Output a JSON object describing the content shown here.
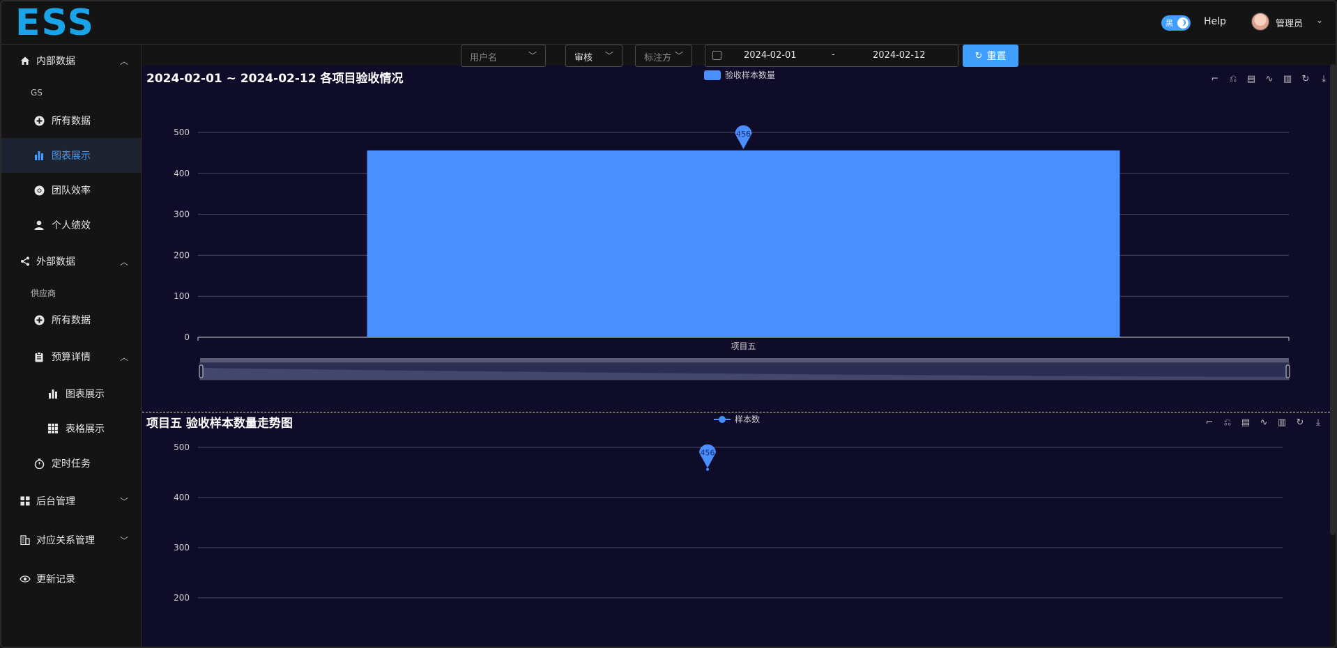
{
  "header": {
    "logo_text": "ESS",
    "theme_toggle_label": "黑",
    "help_label": "Help",
    "user_name": "管理员",
    "user_caret": "⌄"
  },
  "sidebar": {
    "internal_group": {
      "label": "内部数据",
      "icon": "home-icon",
      "expanded": true
    },
    "internal_sub_label": "GS",
    "internal_items": [
      {
        "label": "所有数据",
        "icon": "plus-circle-icon"
      },
      {
        "label": "图表展示",
        "icon": "bar-chart-icon",
        "active": true
      },
      {
        "label": "团队效率",
        "icon": "chrome-icon"
      },
      {
        "label": "个人绩效",
        "icon": "user-icon"
      }
    ],
    "external_group": {
      "label": "外部数据",
      "icon": "share-icon",
      "expanded": true
    },
    "external_sub_label": "供应商",
    "external_items": [
      {
        "label": "所有数据",
        "icon": "plus-circle-icon"
      },
      {
        "label": "预算详情",
        "icon": "clipboard-icon",
        "expanded": true
      }
    ],
    "budget_items": [
      {
        "label": "图表展示",
        "icon": "bar-chart-icon"
      },
      {
        "label": "表格展示",
        "icon": "grid-icon"
      }
    ],
    "timer_item": {
      "label": "定时任务",
      "icon": "timer-icon"
    },
    "admin_group": {
      "label": "后台管理",
      "icon": "apps-icon"
    },
    "mapping_group": {
      "label": "对应关系管理",
      "icon": "building-icon"
    },
    "changelog_item": {
      "label": "更新记录",
      "icon": "eye-icon"
    }
  },
  "filters": {
    "username_placeholder": "用户名",
    "review_value": "审核",
    "annotator_placeholder": "标注方",
    "date_start": "2024-02-01",
    "date_separator": "-",
    "date_end": "2024-02-12",
    "reset_label": "重置"
  },
  "colors": {
    "accent": "#409eff",
    "bar": "#4a8fff",
    "panel_bg": "#0f0c29"
  },
  "chart_data": [
    {
      "type": "bar",
      "title": "2024-02-01 ~ 2024-02-12 各项目验收情况",
      "categories": [
        "项目五"
      ],
      "series": [
        {
          "name": "验收样本数量",
          "values": [
            456
          ]
        }
      ],
      "ylim": [
        0,
        500
      ],
      "yticks": [
        0,
        100,
        200,
        300,
        400,
        500
      ],
      "markpoint": {
        "label": "456",
        "value": 456
      },
      "legend_position": "top-center",
      "grid": true,
      "datazoom": true
    },
    {
      "type": "line",
      "title": "项目五 验收样本数量走势图",
      "series": [
        {
          "name": "样本数",
          "values": [
            456
          ]
        }
      ],
      "ylim_visible": [
        200,
        500
      ],
      "yticks": [
        200,
        300,
        400,
        500
      ],
      "markpoint": {
        "label": "456",
        "value": 456
      },
      "legend_position": "top-center",
      "grid": true
    }
  ],
  "toolbox_icons": [
    "zoom-icon",
    "zoom-reset-icon",
    "data-view-icon",
    "line-switch-icon",
    "bar-switch-icon",
    "restore-icon",
    "save-image-icon"
  ]
}
